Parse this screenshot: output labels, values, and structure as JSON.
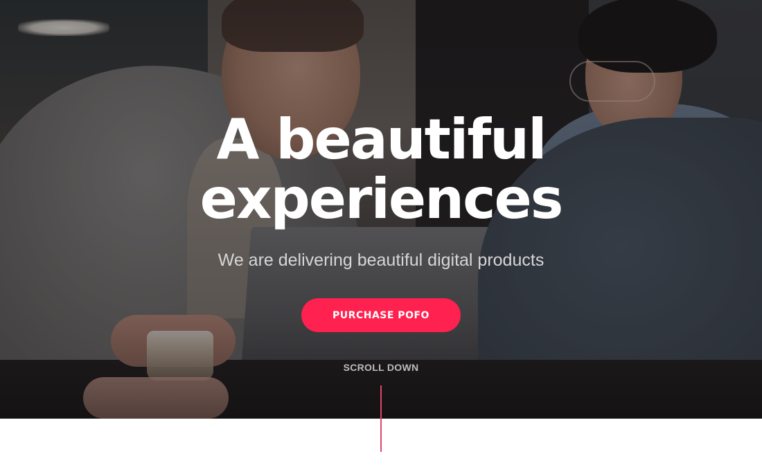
{
  "hero": {
    "title_line1": "A beautiful",
    "title_line2": "experiences",
    "subtitle": "We are delivering beautiful digital products",
    "cta_label": "PURCHASE POFO",
    "scroll_label": "SCROLL DOWN"
  },
  "colors": {
    "accent": "#ff214f",
    "scroll_line": "#e0456a",
    "title": "#ffffff",
    "subtitle": "#d6d6d6",
    "page_background": "#ffffff"
  }
}
